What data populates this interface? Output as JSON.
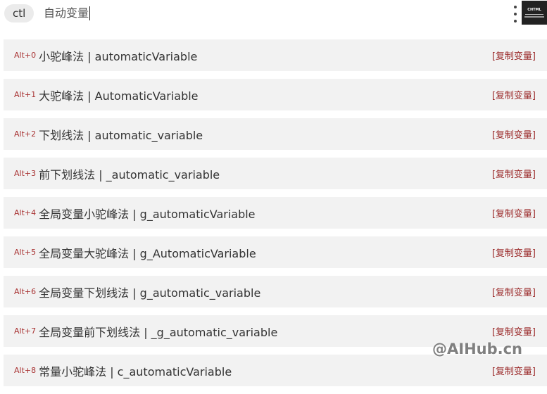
{
  "search": {
    "prefix": "ctl",
    "query": "自动变量"
  },
  "header": {
    "logo_text": "CHTML",
    "menu_icon": "kebab-menu-icon"
  },
  "results": [
    {
      "hotkey": "Alt+0",
      "label": "小驼峰法 | automaticVariable",
      "action": "[复制变量]"
    },
    {
      "hotkey": "Alt+1",
      "label": "大驼峰法 | AutomaticVariable",
      "action": "[复制变量]"
    },
    {
      "hotkey": "Alt+2",
      "label": "下划线法 | automatic_variable",
      "action": "[复制变量]"
    },
    {
      "hotkey": "Alt+3",
      "label": "前下划线法 | _automatic_variable",
      "action": "[复制变量]"
    },
    {
      "hotkey": "Alt+4",
      "label": "全局变量小驼峰法 | g_automaticVariable",
      "action": "[复制变量]"
    },
    {
      "hotkey": "Alt+5",
      "label": "全局变量大驼峰法 | g_AutomaticVariable",
      "action": "[复制变量]"
    },
    {
      "hotkey": "Alt+6",
      "label": "全局变量下划线法 | g_automatic_variable",
      "action": "[复制变量]"
    },
    {
      "hotkey": "Alt+7",
      "label": "全局变量前下划线法 | _g_automatic_variable",
      "action": "[复制变量]"
    },
    {
      "hotkey": "Alt+8",
      "label": "常量小驼峰法 | c_automaticVariable",
      "action": "[复制变量]"
    }
  ],
  "watermark": "@AIHub.cn",
  "colors": {
    "hotkey": "#a83232",
    "action": "#9b2a2a",
    "row_bg": "#f2f2f2"
  }
}
